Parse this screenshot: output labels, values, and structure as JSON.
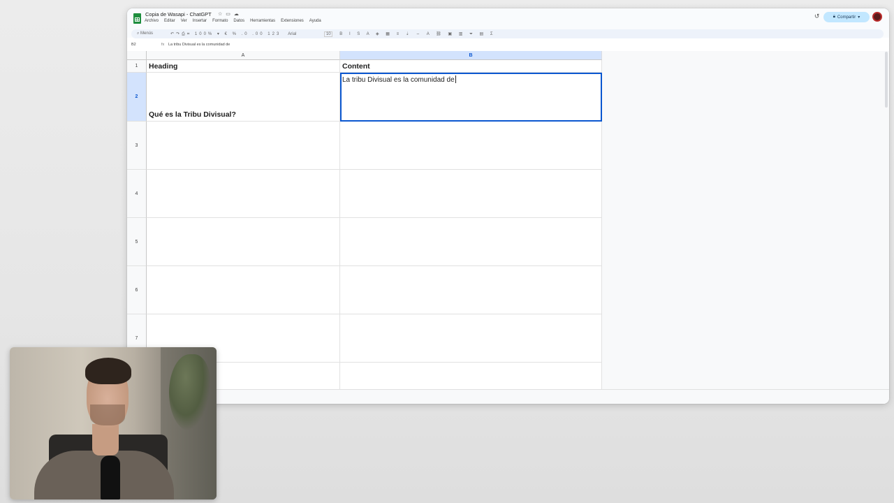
{
  "window": {
    "doc_title": "Copia de Wasapi - ChatGPT",
    "menus": [
      "Archivo",
      "Editar",
      "Ver",
      "Insertar",
      "Formato",
      "Datos",
      "Herramientas",
      "Extensiones",
      "Ayuda"
    ],
    "share_label": "Compartir"
  },
  "toolbar": {
    "menus_label": "Menús",
    "font": "Arial",
    "font_size": "10"
  },
  "formula_bar": {
    "cell_ref": "B2",
    "fx": "fx",
    "content": "La tribu Divisual es la comunidad de"
  },
  "sheet": {
    "columns": [
      "A",
      "B"
    ],
    "rows": [
      "1",
      "2",
      "3",
      "4",
      "5",
      "6",
      "7"
    ],
    "cells": {
      "A1": "Heading",
      "B1": "Content",
      "A2": "Qué es la Tribu Divisual?",
      "B2": "La tribu Divisual es la comunidad de"
    }
  }
}
